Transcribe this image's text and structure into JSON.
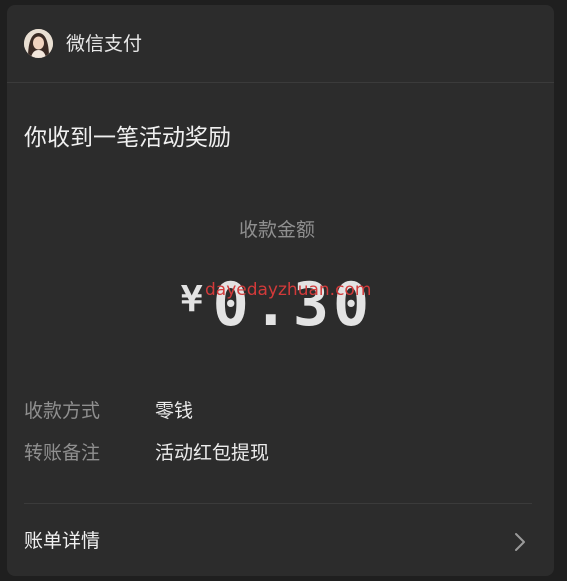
{
  "header": {
    "title": "微信支付",
    "avatar_icon": "user-avatar"
  },
  "message": {
    "title": "你收到一笔活动奖励"
  },
  "amount": {
    "label": "收款金额",
    "currency": "¥",
    "value": "0.30"
  },
  "watermark": {
    "text": "dayedayzhuan.com"
  },
  "details": {
    "rows": [
      {
        "key": "收款方式",
        "value": "零钱"
      },
      {
        "key": "转账备注",
        "value": "活动红包提现"
      }
    ]
  },
  "footer": {
    "label": "账单详情",
    "icon": "chevron-right-icon"
  },
  "colors": {
    "background": "#1f1f1f",
    "card": "#2c2c2c",
    "watermark": "#d23a3a"
  }
}
